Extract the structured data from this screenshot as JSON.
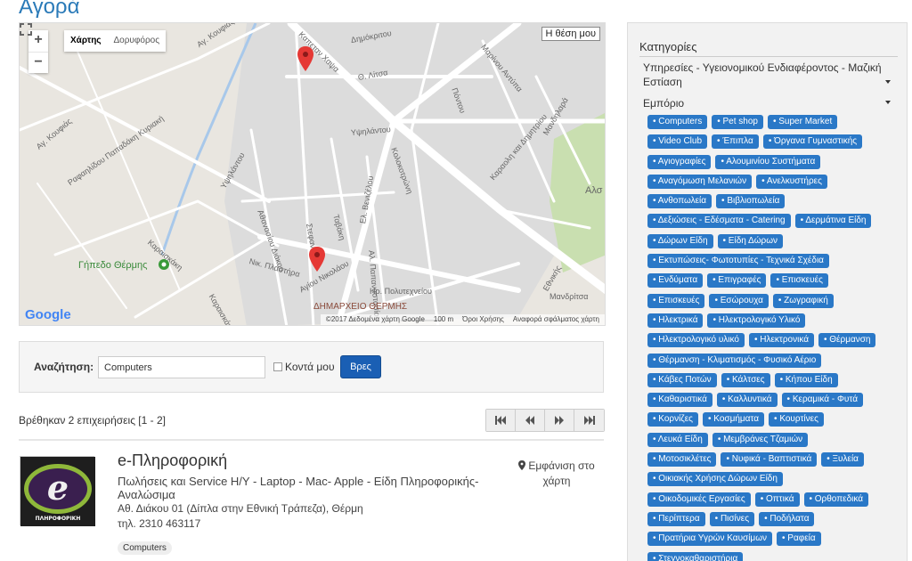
{
  "page_title": "Αγορά",
  "map": {
    "zoom_in": "+",
    "zoom_out": "−",
    "maptypes": [
      "Χάρτης",
      "Δορυφόρος"
    ],
    "my_location": "Η θέση μου",
    "google": "Google",
    "footer": [
      "©2017 Δεδομένα χάρτη Google",
      "100 m",
      "Όροι Χρήσης",
      "Αναφορά σφάλματος χάρτη"
    ],
    "labels": [
      "Αγ. Κουφιάς",
      "Δημόκριτου",
      "Μαρίνου Αντύπα",
      "Καπεταν Χαψα",
      "Θ. Λίτσα",
      "Πόντου",
      "Υψηλάντου",
      "Κολοκοτρώνη",
      "Καραολη και Δημητρίου",
      "Μανδηλαρά",
      "Αγ. Κουφιάς",
      "Ραφαηλίδου Παπαδάκη Κυριακή",
      "Καραισκάκη",
      "Υψηλάντου",
      "Αθανασίου Διάκου",
      "Στεφανίδου",
      "Ταβάκη",
      "Ελ. Βενιζέλου",
      "Αλ. Παπαναστασίου",
      "Γήπεδο Θέρμης",
      "Νικ. Πλαστήρα",
      "Αγίου Νικολάου",
      "Ηρ. Πολυτεχνείου",
      "Καραισκάκη",
      "ΔΗΜΑΡΧΕΙΟ ΘΕΡΜΗΣ",
      "Μανδρίτσα",
      "Αλσ",
      "Εθνικής"
    ]
  },
  "search": {
    "label": "Αναζήτηση:",
    "value": "Computers",
    "nearby_label": "Κοντά μου",
    "button": "Βρες"
  },
  "results": {
    "count_text": "Βρέθηκαν 2 επιχειρήσεις [1 - 2]"
  },
  "business": {
    "name": "e-Πληροφορική",
    "description": "Πωλήσεις και Service Η/Υ - Laptop - Mac- Apple - Είδη Πληροφορικής-Αναλώσιμα",
    "address": "Αθ. Διάκου 01 (Δίπλα στην Εθνική Τράπεζα), Θέρμη",
    "phone": "τηλ. 2310 463117",
    "tag": "Computers",
    "show_on_map": "Εμφάνιση στο χάρτη",
    "logo_text": "ΠΛΗΡΟΦΟΡΙΚΗ"
  },
  "sidebar": {
    "title": "Κατηγορίες",
    "categories": [
      "Υπηρεσίες - Υγειονομικού Ενδιαφέροντος - Μαζική Εστίαση",
      "Εμπόριο"
    ],
    "tag_rows": [
      [
        "Computers",
        "Pet shop",
        "Super Market"
      ],
      [
        "Video Club",
        "Έπιπλα",
        "Όργανα Γυμναστικής"
      ],
      [
        "Αγιογραφίες",
        "Αλουμινίου Συστήματα"
      ],
      [
        "Αναγόμωση Μελανιών",
        "Ανελκυστήρες"
      ],
      [
        "Ανθοπωλεία",
        "Βιβλιοπωλεία"
      ],
      [
        "Δεξιώσεις - Εδέσματα - Catering",
        "Δερμάτινα Είδη"
      ],
      [
        "Δώρων Είδη",
        "Είδη Δώρων"
      ],
      [
        "Εκτυπώσεις- Φωτοτυπίες - Τεχνικά Σχέδια"
      ],
      [
        "Ενδύματα",
        "Επιγραφές",
        "Επισκευές"
      ],
      [
        "Επισκευές",
        "Εσώρουχα",
        "Ζωγραφική"
      ],
      [
        "Ηλεκτρικά",
        "Ηλεκτρολογικό Υλικό"
      ],
      [
        "Ηλεκτρολογικό υλικό",
        "Ηλεκτρονικά",
        "Θέρμανση"
      ],
      [
        "Θέρμανση - Κλιματισμός - Φυσικό Αέριο"
      ],
      [
        "Κάβες Ποτών",
        "Κάλτσες",
        "Κήπου Είδη"
      ],
      [
        "Καθαριστικά",
        "Καλλυντικά",
        "Κεραμικά - Φυτά"
      ],
      [
        "Κορνίζες",
        "Κοσμήματα",
        "Κουρτίνες"
      ],
      [
        "Λευκά Είδη",
        "Μεμβράνες Τζαμιών"
      ],
      [
        "Μοτοσικλέτες",
        "Νυφικά - Βαπτιστικά",
        "Ξυλεία"
      ],
      [
        "Οικιακής Χρήσης Δώρων Είδη"
      ],
      [
        "Οικοδομικές Εργασίες",
        "Οπτικά",
        "Ορθοπεδικά"
      ],
      [
        "Περίπτερα",
        "Πισίνες",
        "Ποδήλατα"
      ],
      [
        "Πρατήρια Υγρών Καυσίμων",
        "Ραφεία"
      ],
      [
        "Στεγνοκαθαριστήρια"
      ]
    ]
  }
}
